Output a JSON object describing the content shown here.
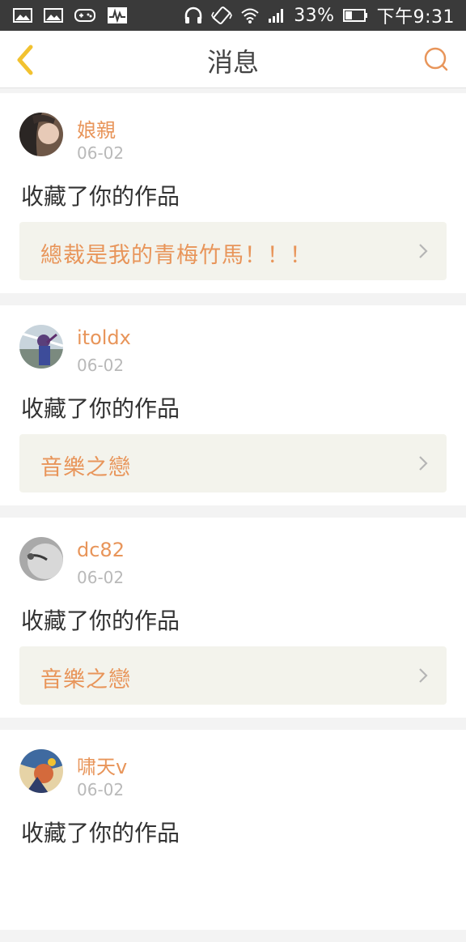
{
  "status_bar": {
    "battery": "33%",
    "time": "下午9:31",
    "icons_left": [
      "image-icon",
      "image-icon",
      "gamepad-icon",
      "activity-icon"
    ],
    "icons_right": [
      "headphones-icon",
      "vibrate-icon",
      "wifi-icon",
      "signal-icon",
      "battery-icon"
    ]
  },
  "header": {
    "title": "消息",
    "back_icon": "chevron-left-icon",
    "search_icon": "search-icon"
  },
  "colors": {
    "accent": "#e8955a",
    "back_icon": "#f2c230",
    "status_bar": "#3a3a3a",
    "card_inner": "#f3f3ec"
  },
  "messages": [
    {
      "user": "娘親",
      "date": "06-02",
      "action": "收藏了你的作品",
      "work": "總裁是我的青梅竹馬！！！"
    },
    {
      "user": "itoldx",
      "date": "06-02",
      "action": "收藏了你的作品",
      "work": "音樂之戀"
    },
    {
      "user": "dc82",
      "date": "06-02",
      "action": "收藏了你的作品",
      "work": "音樂之戀"
    },
    {
      "user": "啸天v",
      "date": "06-02",
      "action": "收藏了你的作品",
      "work": ""
    }
  ]
}
